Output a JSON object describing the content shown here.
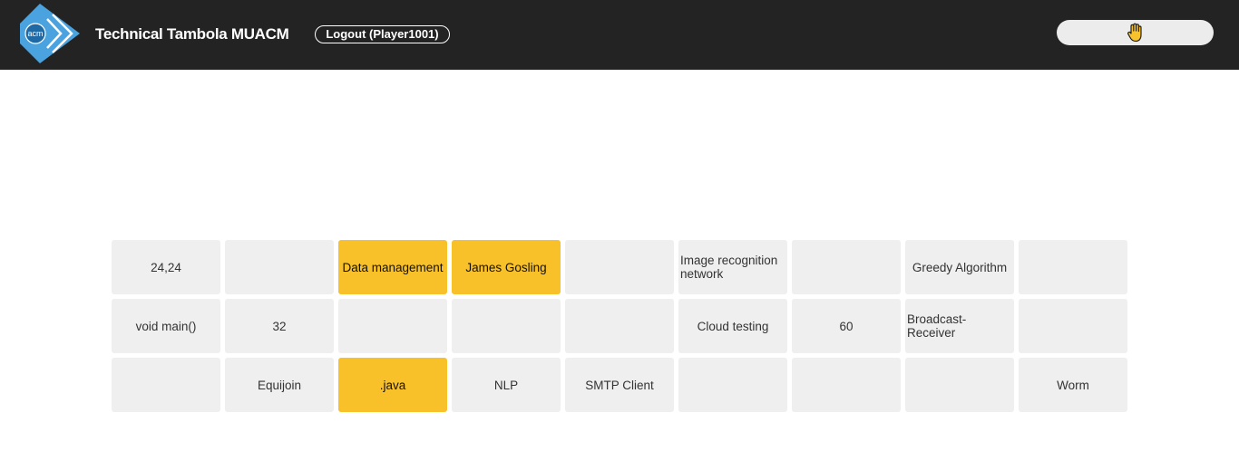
{
  "header": {
    "logo_text": "acm",
    "title": "Technical Tambola MUACM",
    "logout_label": "Logout (Player1001)",
    "claim_icon": "raised-hand-icon"
  },
  "colors": {
    "navbar": "#232323",
    "marked_cell": "#f8c12a",
    "unmarked_cell": "#efefef",
    "logo_blue": "#4aa3df"
  },
  "ticket": {
    "rows": [
      [
        {
          "text": "24,24",
          "marked": false
        },
        {
          "text": "",
          "marked": false
        },
        {
          "text": "Data management",
          "marked": true
        },
        {
          "text": "James Gosling",
          "marked": true
        },
        {
          "text": "",
          "marked": false
        },
        {
          "text": "Image recognition network",
          "marked": false,
          "align": "left"
        },
        {
          "text": "",
          "marked": false
        },
        {
          "text": "Greedy Algorithm",
          "marked": false
        },
        {
          "text": "",
          "marked": false
        }
      ],
      [
        {
          "text": "void main()",
          "marked": false
        },
        {
          "text": "32",
          "marked": false
        },
        {
          "text": "",
          "marked": false
        },
        {
          "text": "",
          "marked": false
        },
        {
          "text": "",
          "marked": false
        },
        {
          "text": "Cloud testing",
          "marked": false
        },
        {
          "text": "60",
          "marked": false
        },
        {
          "text": "Broadcast-Receiver",
          "marked": false,
          "align": "left"
        },
        {
          "text": "",
          "marked": false
        }
      ],
      [
        {
          "text": "",
          "marked": false
        },
        {
          "text": "Equijoin",
          "marked": false
        },
        {
          "text": ".java",
          "marked": true
        },
        {
          "text": "NLP",
          "marked": false
        },
        {
          "text": "SMTP Client",
          "marked": false
        },
        {
          "text": "",
          "marked": false
        },
        {
          "text": "",
          "marked": false
        },
        {
          "text": "",
          "marked": false
        },
        {
          "text": "Worm",
          "marked": false
        }
      ]
    ]
  }
}
